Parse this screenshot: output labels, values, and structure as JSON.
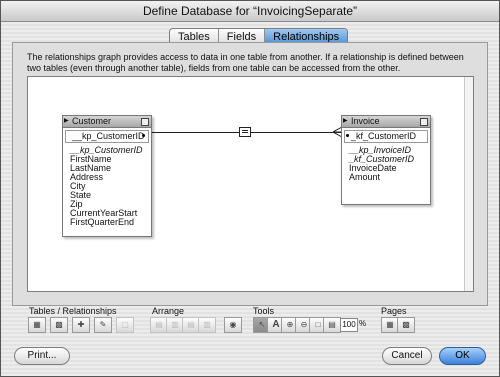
{
  "window": {
    "title": "Define Database for “InvoicingSeparate”"
  },
  "tabs": [
    {
      "label": "Tables"
    },
    {
      "label": "Fields"
    },
    {
      "label": "Relationships",
      "active": true
    }
  ],
  "description": "The relationships graph provides access to data in one table from another. If a relationship is defined between two tables (even through another table), fields from one table can be accessed from the other.",
  "graph": {
    "tables": [
      {
        "name": "Customer",
        "key_field": "__kp_CustomerID",
        "fields": [
          "__kp_CustomerID",
          "FirstName",
          "LastName",
          "Address",
          "City",
          "State",
          "Zip",
          "CurrentYearStart",
          "FirstQuarterEnd"
        ],
        "italic_fields": [
          0
        ]
      },
      {
        "name": "Invoice",
        "key_field": "_kf_CustomerID",
        "fields": [
          "__kp_InvoiceID",
          "_kf_CustomerID",
          "InvoiceDate",
          "Amount"
        ],
        "italic_fields": [
          0,
          1
        ]
      }
    ],
    "relationship_icon": "equals-join-icon"
  },
  "toolbar": {
    "groups": {
      "tables_relationships": "Tables / Relationships",
      "arrange": "Arrange",
      "tools": "Tools",
      "pages": "Pages"
    },
    "zoom_value": "100",
    "zoom_unit": "%"
  },
  "buttons": {
    "print": "Print...",
    "cancel": "Cancel",
    "ok": "OK"
  },
  "colors": {
    "accent": "#4d8fd4"
  }
}
